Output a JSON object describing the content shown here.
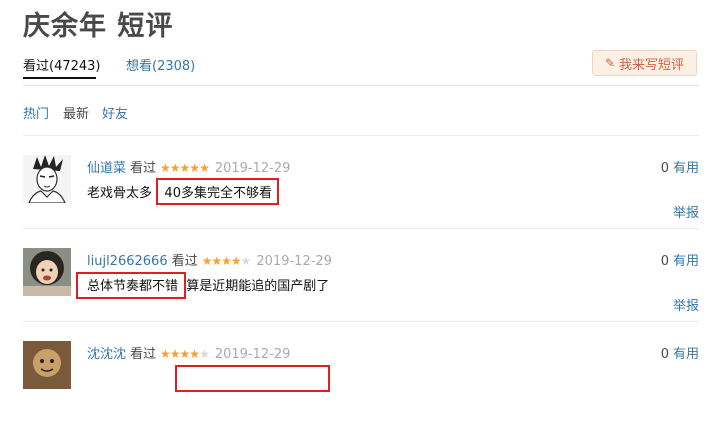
{
  "page": {
    "title": "庆余年 短评"
  },
  "tabs": [
    {
      "label": "看过(47243)"
    },
    {
      "label": "想看(2308)"
    }
  ],
  "write_button": {
    "icon": "pencil-icon",
    "label": "我来写短评"
  },
  "sort": [
    {
      "label": "热门"
    },
    {
      "label": "最新"
    },
    {
      "label": "好友"
    }
  ],
  "colors": {
    "link": "#3377aa",
    "star": "#f9a12c",
    "highlight": "#e02020",
    "button_bg": "#fcefe4"
  },
  "comments": [
    {
      "user": "仙道菜",
      "status": "看过",
      "rating": 5,
      "date": "2019-12-29",
      "text_a": "老戏骨太多",
      "text_b": "40多集完全不够看",
      "votes": "0",
      "useful": "有用",
      "report": "举报"
    },
    {
      "user": "liujl2662666",
      "status": "看过",
      "rating": 4,
      "date": "2019-12-29",
      "text_a": "总体节奏都不错",
      "text_b": "算是近期能追的国产剧了",
      "votes": "0",
      "useful": "有用",
      "report": "举报"
    },
    {
      "user": "沈沈沈",
      "status": "看过",
      "rating": 4,
      "date": "2019-12-29",
      "votes": "0",
      "useful": "有用"
    }
  ]
}
